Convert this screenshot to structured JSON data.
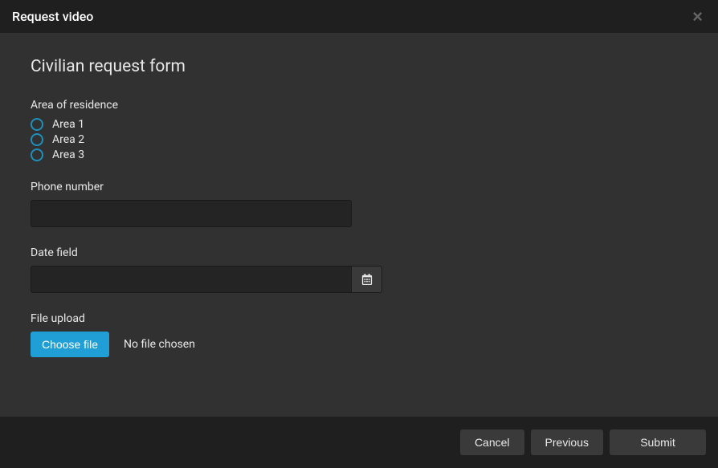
{
  "modal": {
    "title": "Request video"
  },
  "form": {
    "title": "Civilian request form",
    "area": {
      "label": "Area of residence",
      "options": [
        "Area 1",
        "Area 2",
        "Area 3"
      ]
    },
    "phone": {
      "label": "Phone number",
      "value": ""
    },
    "date": {
      "label": "Date field",
      "value": ""
    },
    "file": {
      "label": "File upload",
      "button_label": "Choose file",
      "status": "No file chosen"
    }
  },
  "footer": {
    "cancel": "Cancel",
    "previous": "Previous",
    "submit": "Submit"
  }
}
